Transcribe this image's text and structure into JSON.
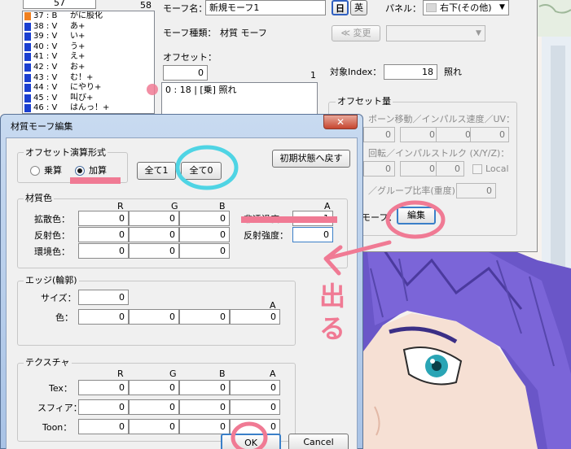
{
  "morph_list": {
    "header_left": "57",
    "header_right": "58",
    "items": [
      {
        "label": "37 : B",
        "name": "がに股化",
        "color": "#f08020"
      },
      {
        "label": "38 : V",
        "name": "あ+",
        "color": "#1a3fd0"
      },
      {
        "label": "39 : V",
        "name": "い+",
        "color": "#1a3fd0"
      },
      {
        "label": "40 : V",
        "name": "う+",
        "color": "#1a3fd0"
      },
      {
        "label": "41 : V",
        "name": "え+",
        "color": "#1a3fd0"
      },
      {
        "label": "42 : V",
        "name": "お+",
        "color": "#1a3fd0"
      },
      {
        "label": "43 : V",
        "name": "む！+",
        "color": "#1a3fd0"
      },
      {
        "label": "44 : V",
        "name": "にやり+",
        "color": "#1a3fd0"
      },
      {
        "label": "45 : V",
        "name": "叫び+",
        "color": "#1a3fd0"
      },
      {
        "label": "46 : V",
        "name": "はんっ！+",
        "color": "#1a3fd0"
      }
    ]
  },
  "morph_panel": {
    "name_label": "モーフ名：",
    "name_value": "新規モーフ1",
    "lang_jp": "日",
    "lang_en": "英",
    "panel_label": "パネル：",
    "panel_value": "右下(その他)",
    "type_label": "モーフ種類：",
    "type_value": "材質 モーフ",
    "change_button": "≪ 変更",
    "offset_label": "オフセット：",
    "offset_count_value": "0",
    "offset_total": "1",
    "offset_item": "0 : 18 | [乗] 照れ",
    "target_index_label": "対象Index：",
    "target_index_value": "18",
    "target_name": "照れ",
    "offset_amount_title": "オフセット量",
    "bone_move_label": "ボーン移動／インパルス速度／UV：",
    "bone_move_values": [
      "0",
      "0",
      "0",
      "0"
    ],
    "rotation_label": "回転／インパルストルク (X/Y/Z)：",
    "rotation_values": [
      "0",
      "0",
      "0"
    ],
    "local_label": "Local",
    "group_label": "／グループ比率(重度)：",
    "group_value": "0",
    "morph_label": "モーフ：",
    "edit_button": "編集"
  },
  "dialog": {
    "title": "材質モーフ編集",
    "close_icon": "close-icon",
    "calc_group_title": "オフセット演算形式",
    "radio_mul": "乗算",
    "radio_add": "加算",
    "selected_mode": "加算",
    "all1_button": "全て1",
    "all0_button": "全て0",
    "reset_button": "初期状態へ戻す",
    "material_title": "材質色",
    "col_r": "R",
    "col_g": "G",
    "col_b": "B",
    "col_a": "A",
    "rows": [
      {
        "label": "拡散色：",
        "values": [
          "0",
          "0",
          "0"
        ]
      },
      {
        "label": "反射色：",
        "values": [
          "0",
          "0",
          "0"
        ]
      },
      {
        "label": "環境色：",
        "values": [
          "0",
          "0",
          "0"
        ]
      }
    ],
    "alpha_label": "非透過度：",
    "alpha_value": "1",
    "specular_power_label": "反射強度：",
    "specular_power_value": "0",
    "edge_title": "エッジ(輪郭)",
    "edge_size_label": "サイズ：",
    "edge_size_value": "0",
    "edge_color_label": "色：",
    "edge_color_values": [
      "0",
      "0",
      "0",
      "0"
    ],
    "texture_title": "テクスチャ",
    "texture_rows": [
      {
        "label": "Tex：",
        "values": [
          "0",
          "0",
          "0",
          "0"
        ]
      },
      {
        "label": "スフィア：",
        "values": [
          "0",
          "0",
          "0",
          "0"
        ]
      },
      {
        "label": "Toon：",
        "values": [
          "0",
          "0",
          "0",
          "0"
        ]
      }
    ],
    "ok_button": "OK",
    "cancel_button": "Cancel"
  },
  "annotations": {
    "handwritten_text": "出る",
    "pink": "#f07a94",
    "cyan": "#4fd4e4"
  }
}
